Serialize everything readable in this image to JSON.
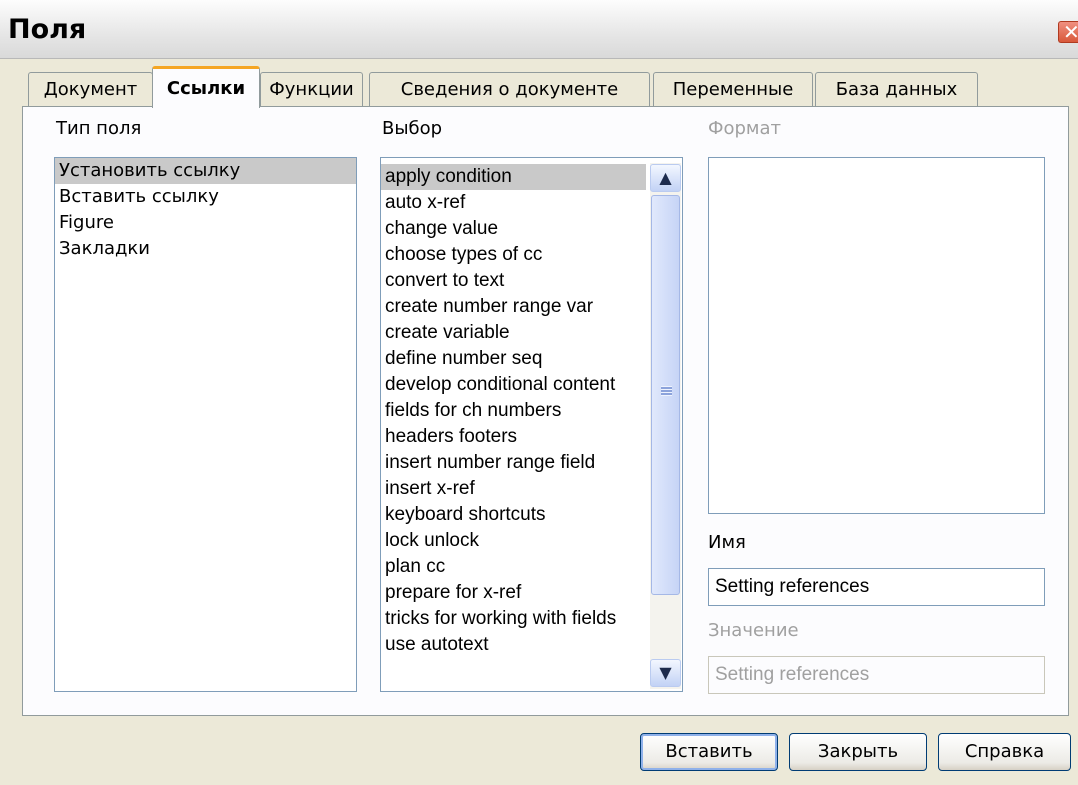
{
  "window": {
    "title": "Поля"
  },
  "tabs": [
    "Документ",
    "Ссылки",
    "Функции",
    "Сведения о документе",
    "Переменные",
    "База данных"
  ],
  "active_tab": "Ссылки",
  "field_type": {
    "label": "Тип поля",
    "items": [
      "Установить ссылку",
      "Вставить ссылку",
      "Figure",
      "Закладки"
    ],
    "selected": "Установить ссылку"
  },
  "choice": {
    "label": "Выбор",
    "items": [
      "apply condition",
      "auto x-ref",
      "change value",
      "choose types of cc",
      "convert to text",
      "create number range var",
      "create variable",
      "define number seq",
      "develop conditional content",
      "fields for ch numbers",
      "headers footers",
      "insert number range field",
      "insert x-ref",
      "keyboard shortcuts",
      "lock unlock",
      "plan cc",
      "prepare for x-ref",
      "tricks for working with fields",
      "use autotext"
    ],
    "selected": "apply condition"
  },
  "format": {
    "label": "Формат"
  },
  "name": {
    "label": "Имя",
    "value": "Setting references"
  },
  "value": {
    "label": "Значение",
    "value": "Setting references"
  },
  "buttons": {
    "insert": "Вставить",
    "close": "Закрыть",
    "help": "Справка"
  },
  "icons": {
    "close": "close-icon",
    "scroll_up": "chevron-up-icon",
    "scroll_down": "chevron-down-icon"
  }
}
